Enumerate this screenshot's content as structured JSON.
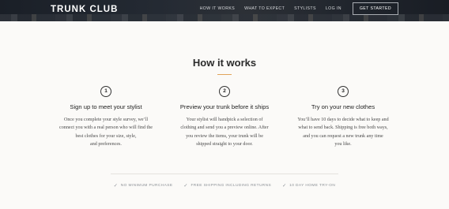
{
  "header": {
    "logo": "TRUNK CLUB",
    "nav": [
      {
        "label": "HOW IT WORKS"
      },
      {
        "label": "WHAT TO EXPECT"
      },
      {
        "label": "STYLISTS"
      },
      {
        "label": "LOG IN"
      }
    ],
    "cta": "GET STARTED"
  },
  "main": {
    "title": "How it works",
    "accent_color": "#e0a45a",
    "steps": [
      {
        "number": "1",
        "heading": "Sign up to meet your stylist",
        "lines": [
          "Once you complete your style survey, we’ll",
          "connect you with a real person who will find the",
          "best clothes for your size, style,",
          "and preferences."
        ]
      },
      {
        "number": "2",
        "heading": "Preview your trunk before it ships",
        "lines": [
          "Your stylist will handpick a selection of",
          "clothing and send you a preview online. After",
          "you review the items, your trunk will be",
          "shipped straight to your door."
        ]
      },
      {
        "number": "3",
        "heading": "Try on your new clothes",
        "lines": [
          "You’ll have 10 days to decide what to keep and",
          "what to send back. Shipping is free both ways,",
          "and you can request a new trunk any time",
          "you like."
        ]
      }
    ]
  },
  "features": [
    {
      "icon": "check-icon",
      "label": "NO MINIMUM PURCHASE"
    },
    {
      "icon": "check-icon",
      "label": "FREE SHIPPING INCLUDING RETURNS"
    },
    {
      "icon": "check-icon",
      "label": "10 DAY HOME TRY-ON"
    }
  ]
}
